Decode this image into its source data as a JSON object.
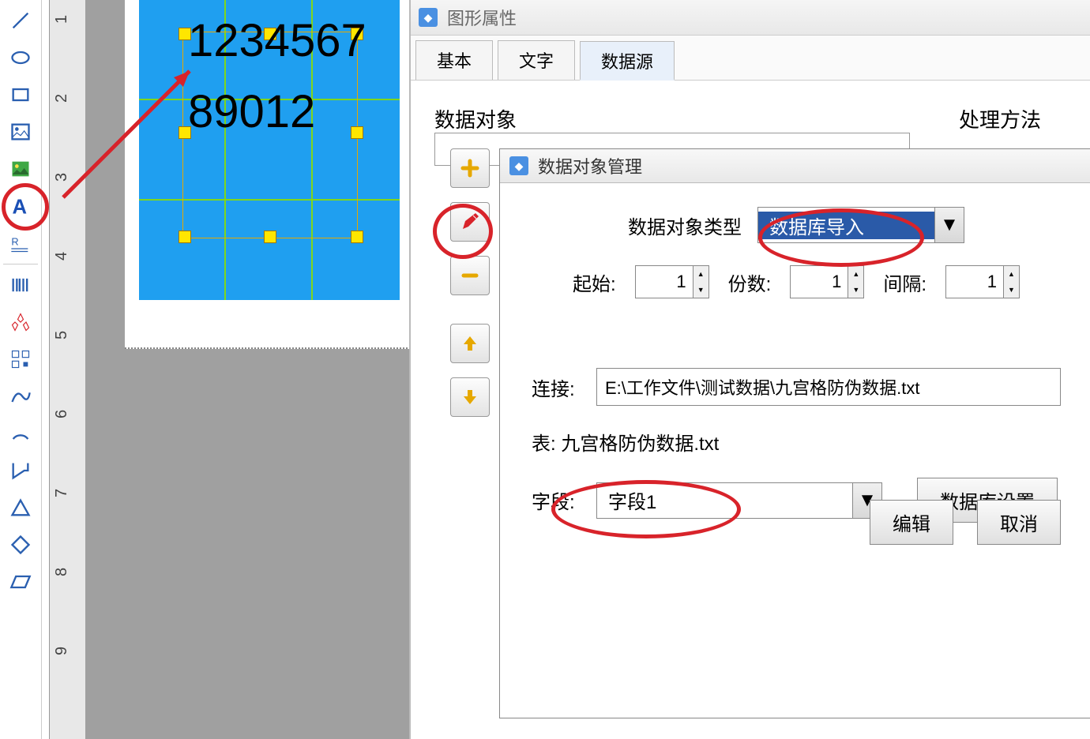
{
  "panel_title": "图形属性",
  "tabs": [
    "基本",
    "文字",
    "数据源"
  ],
  "active_tab": 2,
  "section_data_object": "数据对象",
  "section_method": "处理方法",
  "dialog_title": "数据对象管理",
  "form": {
    "type_label": "数据对象类型",
    "type_value": "数据库导入",
    "start_label": "起始:",
    "start_value": "1",
    "copies_label": "份数:",
    "copies_value": "1",
    "interval_label": "间隔:",
    "interval_value": "1",
    "connect_label": "连接:",
    "connect_value": "E:\\工作文件\\测试数据\\九宫格防伪数据.txt",
    "table_label": "表: 九宫格防伪数据.txt",
    "field_label": "字段:",
    "field_value": "字段1",
    "db_settings_btn": "数据库设置",
    "edit_btn": "编辑",
    "cancel_btn": "取消"
  },
  "canvas": {
    "text_line1": "1234567",
    "text_line2": "89012"
  },
  "ruler_marks": [
    "1",
    "2",
    "3",
    "4",
    "5",
    "6",
    "7",
    "8",
    "9"
  ],
  "tool_icons": [
    "line",
    "ellipse",
    "rect",
    "image",
    "image2",
    "text",
    "richtext",
    "sep",
    "barcode",
    "logo",
    "qr",
    "curve",
    "arc",
    "poly",
    "triangle",
    "diamond",
    "parallelogram"
  ]
}
